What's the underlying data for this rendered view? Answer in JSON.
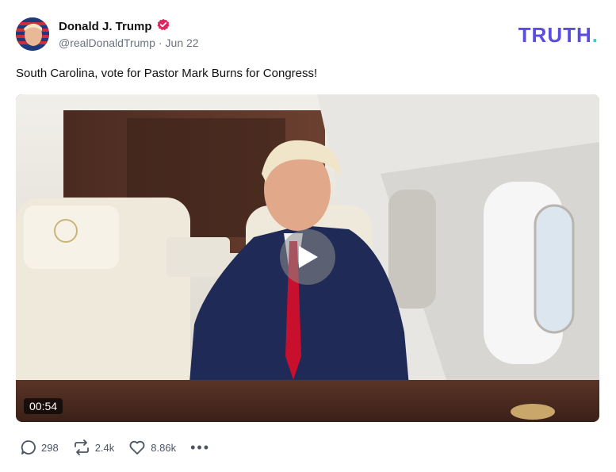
{
  "post": {
    "author_name": "Donald J. Trump",
    "handle": "@realDonaldTrump",
    "separator": "·",
    "date": "Jun 22",
    "text": "South Carolina, vote for Pastor Mark Burns for Congress!"
  },
  "brand": {
    "logo_main": "TRUTH",
    "logo_dot": ".",
    "logo_color": "#5b4de0",
    "dot_color": "#2dd4bf"
  },
  "media": {
    "duration": "00:54",
    "play_icon": "play-icon"
  },
  "actions": {
    "replies": "298",
    "retruths": "2.4k",
    "likes": "8.86k",
    "more": "•••"
  },
  "colors": {
    "verified": "#e0245e",
    "text_muted": "#6b7280"
  }
}
